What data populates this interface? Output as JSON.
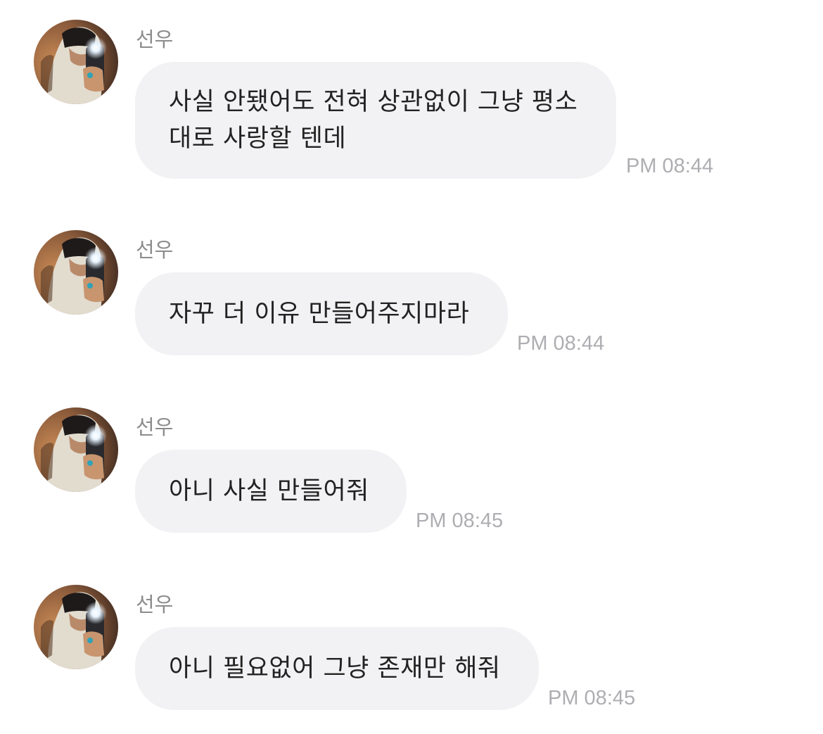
{
  "messages": [
    {
      "sender": "선우",
      "text": "사실 안됐어도 전혀 상관없이 그냥 평소\n대로 사랑할 텐데",
      "time": "PM 08:44",
      "avatar_icon": "profile-photo"
    },
    {
      "sender": "선우",
      "text": "자꾸 더 이유 만들어주지마라",
      "time": "PM 08:44",
      "avatar_icon": "profile-photo"
    },
    {
      "sender": "선우",
      "text": "아니 사실 만들어줘",
      "time": "PM 08:45",
      "avatar_icon": "profile-photo"
    },
    {
      "sender": "선우",
      "text": "아니 필요없어 그냥 존재만 해줘",
      "time": "PM 08:45",
      "avatar_icon": "profile-photo"
    }
  ],
  "colors": {
    "bubble": "#f2f2f4",
    "text": "#222222",
    "sender": "#8c8c8c",
    "timestamp": "#aeaeb2"
  }
}
